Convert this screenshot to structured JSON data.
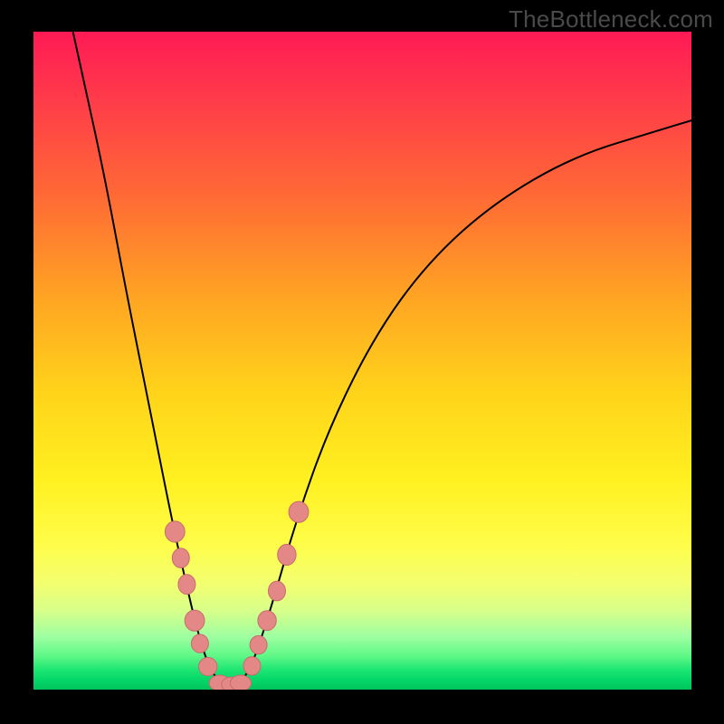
{
  "watermark": "TheBottleneck.com",
  "colors": {
    "background": "#000000",
    "gradient_top": "#ff1a55",
    "gradient_bottom": "#00c45c",
    "curve": "#000000",
    "bead_fill": "#e38787",
    "bead_stroke": "#c76c6c"
  },
  "chart_data": {
    "type": "line",
    "title": "",
    "xlabel": "",
    "ylabel": "",
    "xlim": [
      0,
      100
    ],
    "ylim": [
      0,
      100
    ],
    "axes_visible": false,
    "grid_visible": false,
    "series": [
      {
        "name": "bottleneck-curve",
        "points": [
          {
            "x": 6.0,
            "y": 100.0
          },
          {
            "x": 8.0,
            "y": 91.0
          },
          {
            "x": 11.0,
            "y": 77.0
          },
          {
            "x": 14.0,
            "y": 61.0
          },
          {
            "x": 17.0,
            "y": 46.0
          },
          {
            "x": 19.0,
            "y": 36.0
          },
          {
            "x": 21.0,
            "y": 26.0
          },
          {
            "x": 23.0,
            "y": 17.0
          },
          {
            "x": 25.0,
            "y": 8.5
          },
          {
            "x": 27.0,
            "y": 2.5
          },
          {
            "x": 29.0,
            "y": 0.8
          },
          {
            "x": 31.0,
            "y": 0.8
          },
          {
            "x": 33.0,
            "y": 3.0
          },
          {
            "x": 36.0,
            "y": 12.0
          },
          {
            "x": 40.0,
            "y": 26.0
          },
          {
            "x": 45.0,
            "y": 40.0
          },
          {
            "x": 52.0,
            "y": 54.0
          },
          {
            "x": 60.0,
            "y": 65.0
          },
          {
            "x": 70.0,
            "y": 74.0
          },
          {
            "x": 82.0,
            "y": 81.0
          },
          {
            "x": 95.0,
            "y": 85.0
          },
          {
            "x": 100.0,
            "y": 86.5
          }
        ]
      }
    ],
    "markers": [
      {
        "x": 21.5,
        "y": 24.0,
        "rx": 1.5,
        "ry": 1.6
      },
      {
        "x": 22.4,
        "y": 20.0,
        "rx": 1.3,
        "ry": 1.5
      },
      {
        "x": 23.3,
        "y": 16.0,
        "rx": 1.3,
        "ry": 1.5
      },
      {
        "x": 24.5,
        "y": 10.5,
        "rx": 1.5,
        "ry": 1.6
      },
      {
        "x": 25.3,
        "y": 7.0,
        "rx": 1.3,
        "ry": 1.4
      },
      {
        "x": 26.5,
        "y": 3.5,
        "rx": 1.4,
        "ry": 1.4
      },
      {
        "x": 28.3,
        "y": 1.0,
        "rx": 1.6,
        "ry": 1.2
      },
      {
        "x": 30.0,
        "y": 0.8,
        "rx": 1.4,
        "ry": 1.1
      },
      {
        "x": 31.5,
        "y": 1.0,
        "rx": 1.6,
        "ry": 1.2
      },
      {
        "x": 33.2,
        "y": 3.6,
        "rx": 1.3,
        "ry": 1.4
      },
      {
        "x": 34.2,
        "y": 6.8,
        "rx": 1.3,
        "ry": 1.4
      },
      {
        "x": 35.5,
        "y": 10.5,
        "rx": 1.4,
        "ry": 1.5
      },
      {
        "x": 37.0,
        "y": 15.0,
        "rx": 1.3,
        "ry": 1.5
      },
      {
        "x": 38.5,
        "y": 20.5,
        "rx": 1.4,
        "ry": 1.6
      },
      {
        "x": 40.3,
        "y": 27.0,
        "rx": 1.5,
        "ry": 1.6
      }
    ],
    "note": "Values are percentages in 0–100 space. y increases upward. Curve is a V-shaped bottleneck profile with minimum near x≈30."
  }
}
